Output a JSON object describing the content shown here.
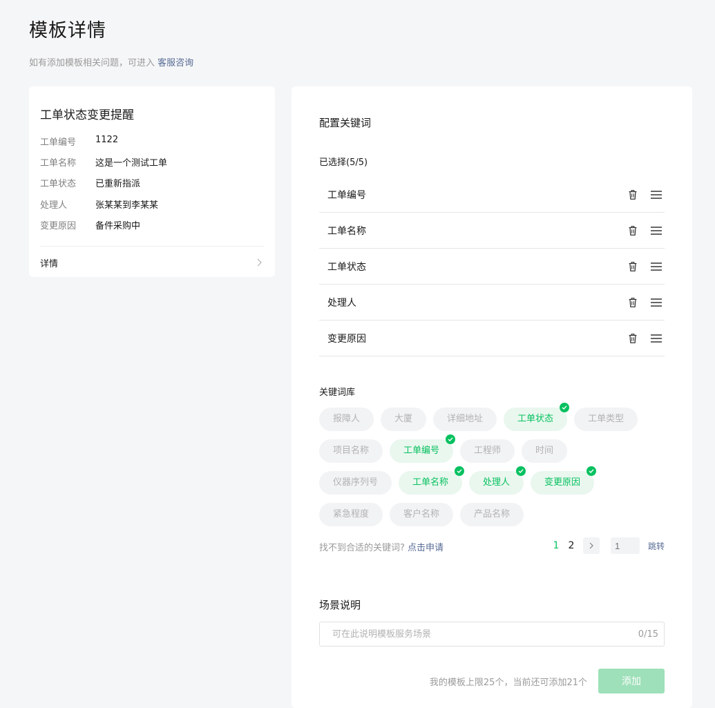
{
  "page": {
    "title": "模板详情",
    "subtitle": "如有添加模板相关问题，可进入",
    "support_link": "客服咨询"
  },
  "preview": {
    "title": "工单状态变更提醒",
    "rows": [
      {
        "key": "工单编号",
        "value": "1122"
      },
      {
        "key": "工单名称",
        "value": "这是一个测试工单"
      },
      {
        "key": "工单状态",
        "value": "已重新指派"
      },
      {
        "key": "处理人",
        "value": "张某某到李某某"
      },
      {
        "key": "变更原因",
        "value": "备件采购中"
      }
    ],
    "detail_label": "详情"
  },
  "config": {
    "title": "配置关键词",
    "selected_label": "已选择(5/5)",
    "selected": [
      "工单编号",
      "工单名称",
      "工单状态",
      "处理人",
      "变更原因"
    ],
    "library_title": "关键词库",
    "library": [
      [
        {
          "label": "报障人",
          "selected": false
        },
        {
          "label": "大厦",
          "selected": false
        },
        {
          "label": "详细地址",
          "selected": false
        },
        {
          "label": "工单状态",
          "selected": true
        },
        {
          "label": "工单类型",
          "selected": false
        }
      ],
      [
        {
          "label": "项目名称",
          "selected": false
        },
        {
          "label": "工单编号",
          "selected": true
        },
        {
          "label": "工程师",
          "selected": false
        },
        {
          "label": "时间",
          "selected": false
        }
      ],
      [
        {
          "label": "仪器序列号",
          "selected": false
        },
        {
          "label": "工单名称",
          "selected": true
        },
        {
          "label": "处理人",
          "selected": true
        },
        {
          "label": "变更原因",
          "selected": true
        }
      ],
      [
        {
          "label": "紧急程度",
          "selected": false
        },
        {
          "label": "客户名称",
          "selected": false
        },
        {
          "label": "产品名称",
          "selected": false
        }
      ]
    ],
    "hint": "找不到合适的关键词?",
    "apply_link": "点击申请",
    "pagination": {
      "pages": [
        "1",
        "2"
      ],
      "current_page": "1",
      "jump_placeholder": "1",
      "jump_label": "跳转"
    }
  },
  "scene": {
    "title": "场景说明",
    "placeholder": "可在此说明模板服务场景",
    "counter": "0/15"
  },
  "footer": {
    "limit_text": "我的模板上限25个，当前还可添加21个",
    "add_label": "添加"
  },
  "colors": {
    "accent": "#07c160",
    "link": "#576b95",
    "disabled_button": "#9ee0b9"
  }
}
